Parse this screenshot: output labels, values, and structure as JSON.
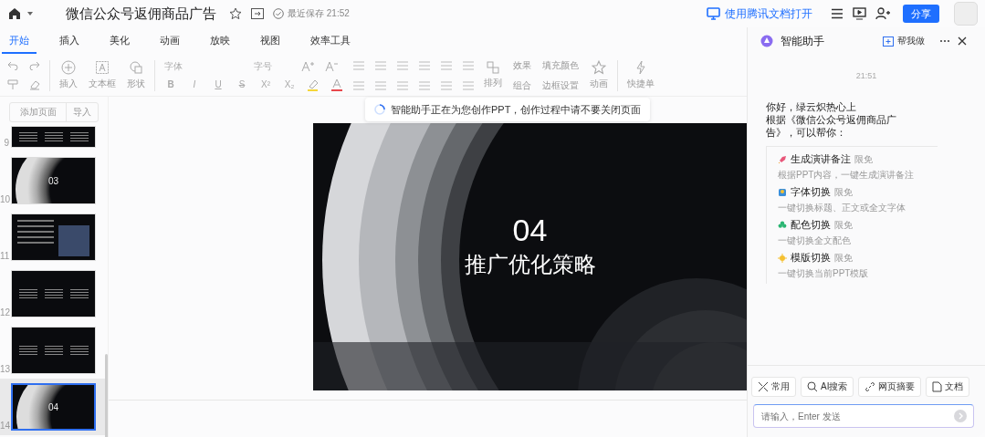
{
  "topbar": {
    "title": "微信公众号返佣商品广告",
    "save_status": "最近保存 21:52",
    "open_in": "使用腾讯文档打开",
    "share": "分享"
  },
  "tabs": [
    {
      "label": "开始",
      "selected": true
    },
    {
      "label": "插入",
      "selected": false
    },
    {
      "label": "美化",
      "selected": false
    },
    {
      "label": "动画",
      "selected": false
    },
    {
      "label": "放映",
      "selected": false
    },
    {
      "label": "视图",
      "selected": false
    },
    {
      "label": "效率工具",
      "selected": false
    }
  ],
  "toolbar": {
    "insert": [
      "插入",
      "文本框",
      "形状"
    ],
    "font_placeholder": "字体",
    "size_placeholder": "字号",
    "format_glyphs": [
      "B",
      "I",
      "U",
      "S",
      "X²",
      "X₂"
    ],
    "arrange": "排列",
    "effect": "效果",
    "group": "组合",
    "fill": "填充颜色",
    "border": "边框设置",
    "animation": "动画",
    "quick": "快捷单"
  },
  "slides_panel": {
    "add_page": "添加页面",
    "import": "导入"
  },
  "thumbnails": [
    {
      "number": "9",
      "kind": "content",
      "selected": false
    },
    {
      "number": "10",
      "kind": "section",
      "selected": false,
      "heading": "03"
    },
    {
      "number": "11",
      "kind": "photo",
      "selected": false
    },
    {
      "number": "12",
      "kind": "content",
      "selected": false
    },
    {
      "number": "13",
      "kind": "content",
      "selected": false
    },
    {
      "number": "14",
      "kind": "section",
      "selected": true,
      "heading": "04"
    }
  ],
  "toast": "智能助手正在为您创作PPT，创作过程中请不要关闭页面",
  "slide": {
    "number": "04",
    "title": "推广优化策略"
  },
  "assistant": {
    "title": "智能助手",
    "do_for_me": "帮我做",
    "time": "21:51",
    "greeting": "你好，绿云炽热心上",
    "intro": "根据《微信公众号返佣商品广告》，可以帮你：",
    "skills": [
      {
        "kind": "rocket",
        "name": "生成演讲备注",
        "badge": "限免",
        "desc": "根据PPT内容，一键生成演讲备注"
      },
      {
        "kind": "font",
        "name": "字体切换",
        "badge": "限免",
        "desc": "一键切换标题、正文或全文字体"
      },
      {
        "kind": "palette",
        "name": "配色切换",
        "badge": "限免",
        "desc": "一键切换全文配色"
      },
      {
        "kind": "template",
        "name": "模版切换",
        "badge": "限免",
        "desc": "一键切换当前PPT模版"
      }
    ],
    "actions": [
      {
        "kind": "tools",
        "label": "常用"
      },
      {
        "kind": "search",
        "label": "AI搜索"
      },
      {
        "kind": "link",
        "label": "网页摘要"
      },
      {
        "kind": "doc",
        "label": "文档"
      }
    ],
    "input_placeholder": "请输入，Enter 发送"
  }
}
